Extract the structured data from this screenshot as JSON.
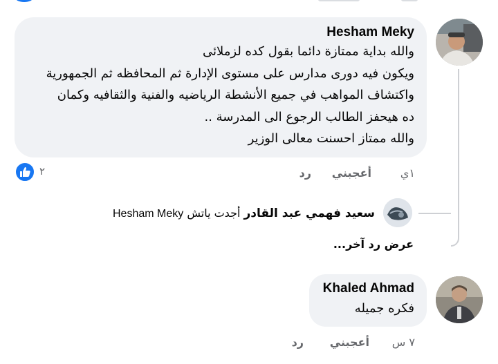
{
  "comments": [
    {
      "author": "Hesham Meky",
      "text": "والله بداية ممتازة دائما بقول كده لزملائى\nويكون فيه دورى مدارس على مستوى الإدارة ثم المحافظه ثم الجمهورية\nواكتشاف المواهب في جميع الأنشطة الرياضيه والفنية والثقافيه وكمان\nده هيحفز الطالب الرجوع الى المدرسة ..\nوالله ممتاز احسنت معالى الوزير",
      "time": "١ي",
      "like_label": "أعجبني",
      "reply_label": "رد",
      "reaction_count": "٢",
      "reply_preview": {
        "author": "سعيد فهمي عبد القادر",
        "action": "أجدت ياتش",
        "mention": "Hesham Meky"
      },
      "more_replies_label": "عرض رد آخر..."
    },
    {
      "author": "Khaled Ahmad",
      "text": "فكره جميله",
      "time": "٧ س",
      "like_label": "أعجبني",
      "reply_label": "رد"
    }
  ],
  "colors": {
    "bubble": "#f0f2f5",
    "secondary_text": "#65676b",
    "like_blue": "#1877f2",
    "thread_line": "#ced0d4"
  },
  "icons": [
    "like-reaction-icon",
    "avatar-photo"
  ]
}
